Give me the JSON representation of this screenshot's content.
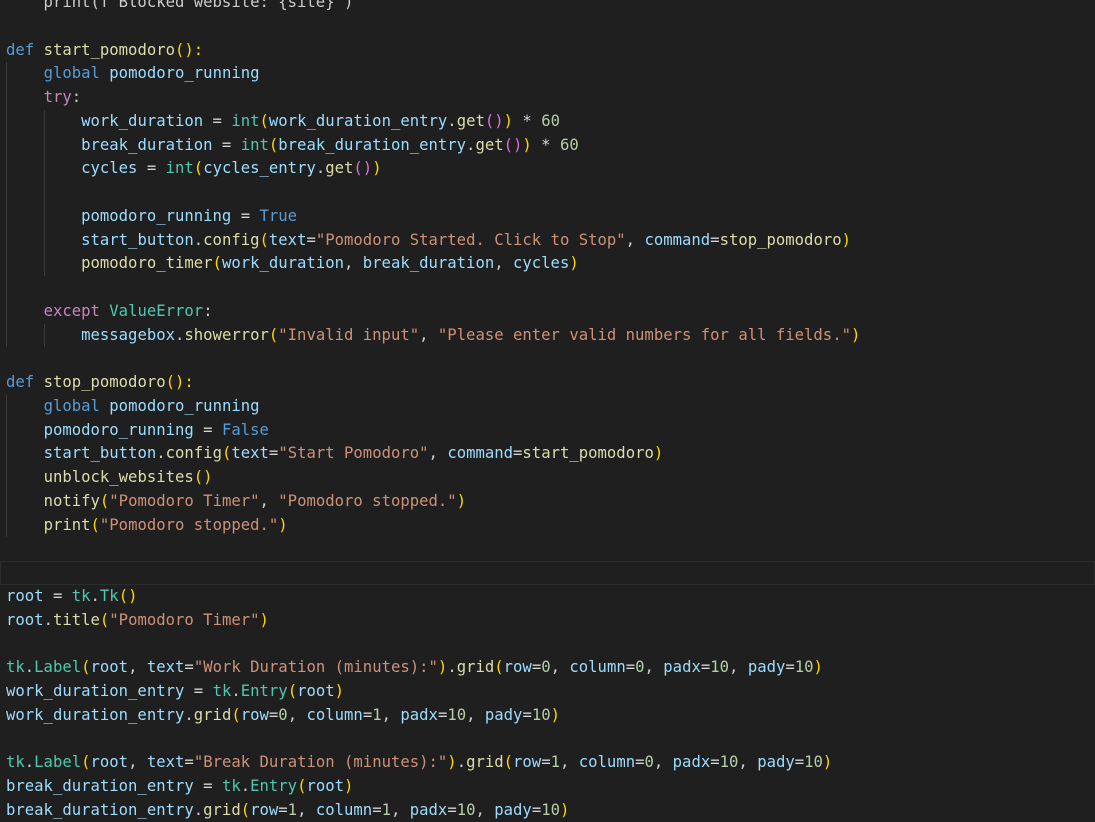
{
  "editor": {
    "lines": [
      {
        "indent": 0,
        "tokens": [
          {
            "t": "    print(f\"Blocked website: {site}\")",
            "c": "pn"
          }
        ]
      },
      {
        "indent": 0,
        "tokens": []
      },
      {
        "indent": 0,
        "tokens": [
          {
            "t": "def",
            "c": "kw"
          },
          {
            "t": " ",
            "c": "pn"
          },
          {
            "t": "start_pomodoro",
            "c": "fn"
          },
          {
            "t": "():",
            "c": "b1"
          }
        ]
      },
      {
        "indent": 1,
        "tokens": [
          {
            "t": "global",
            "c": "kw"
          },
          {
            "t": " ",
            "c": "pn"
          },
          {
            "t": "pomodoro_running",
            "c": "var"
          }
        ]
      },
      {
        "indent": 1,
        "tokens": [
          {
            "t": "try",
            "c": "ctl"
          },
          {
            "t": ":",
            "c": "pn"
          }
        ]
      },
      {
        "indent": 2,
        "tokens": [
          {
            "t": "work_duration",
            "c": "var"
          },
          {
            "t": " = ",
            "c": "op"
          },
          {
            "t": "int",
            "c": "cls"
          },
          {
            "t": "(",
            "c": "b1"
          },
          {
            "t": "work_duration_entry",
            "c": "var"
          },
          {
            "t": ".",
            "c": "pn"
          },
          {
            "t": "get",
            "c": "fn"
          },
          {
            "t": "()",
            "c": "b2"
          },
          {
            "t": ")",
            "c": "b1"
          },
          {
            "t": " * ",
            "c": "op"
          },
          {
            "t": "60",
            "c": "num"
          }
        ]
      },
      {
        "indent": 2,
        "tokens": [
          {
            "t": "break_duration",
            "c": "var"
          },
          {
            "t": " = ",
            "c": "op"
          },
          {
            "t": "int",
            "c": "cls"
          },
          {
            "t": "(",
            "c": "b1"
          },
          {
            "t": "break_duration_entry",
            "c": "var"
          },
          {
            "t": ".",
            "c": "pn"
          },
          {
            "t": "get",
            "c": "fn"
          },
          {
            "t": "()",
            "c": "b2"
          },
          {
            "t": ")",
            "c": "b1"
          },
          {
            "t": " * ",
            "c": "op"
          },
          {
            "t": "60",
            "c": "num"
          }
        ]
      },
      {
        "indent": 2,
        "tokens": [
          {
            "t": "cycles",
            "c": "var"
          },
          {
            "t": " = ",
            "c": "op"
          },
          {
            "t": "int",
            "c": "cls"
          },
          {
            "t": "(",
            "c": "b1"
          },
          {
            "t": "cycles_entry",
            "c": "var"
          },
          {
            "t": ".",
            "c": "pn"
          },
          {
            "t": "get",
            "c": "fn"
          },
          {
            "t": "()",
            "c": "b2"
          },
          {
            "t": ")",
            "c": "b1"
          }
        ]
      },
      {
        "indent": 2,
        "tokens": []
      },
      {
        "indent": 2,
        "tokens": [
          {
            "t": "pomodoro_running",
            "c": "var"
          },
          {
            "t": " = ",
            "c": "op"
          },
          {
            "t": "True",
            "c": "con"
          }
        ]
      },
      {
        "indent": 2,
        "tokens": [
          {
            "t": "start_button",
            "c": "var"
          },
          {
            "t": ".",
            "c": "pn"
          },
          {
            "t": "config",
            "c": "fn"
          },
          {
            "t": "(",
            "c": "b1"
          },
          {
            "t": "text",
            "c": "var"
          },
          {
            "t": "=",
            "c": "op"
          },
          {
            "t": "\"Pomodoro Started. Click to Stop\"",
            "c": "str"
          },
          {
            "t": ", ",
            "c": "pn"
          },
          {
            "t": "command",
            "c": "var"
          },
          {
            "t": "=",
            "c": "op"
          },
          {
            "t": "stop_pomodoro",
            "c": "fn"
          },
          {
            "t": ")",
            "c": "b1"
          }
        ]
      },
      {
        "indent": 2,
        "tokens": [
          {
            "t": "pomodoro_timer",
            "c": "fn"
          },
          {
            "t": "(",
            "c": "b1"
          },
          {
            "t": "work_duration",
            "c": "var"
          },
          {
            "t": ", ",
            "c": "pn"
          },
          {
            "t": "break_duration",
            "c": "var"
          },
          {
            "t": ", ",
            "c": "pn"
          },
          {
            "t": "cycles",
            "c": "var"
          },
          {
            "t": ")",
            "c": "b1"
          }
        ]
      },
      {
        "indent": 1,
        "tokens": []
      },
      {
        "indent": 1,
        "tokens": [
          {
            "t": "except",
            "c": "ctl"
          },
          {
            "t": " ",
            "c": "pn"
          },
          {
            "t": "ValueError",
            "c": "cls"
          },
          {
            "t": ":",
            "c": "pn"
          }
        ]
      },
      {
        "indent": 2,
        "tokens": [
          {
            "t": "messagebox",
            "c": "var"
          },
          {
            "t": ".",
            "c": "pn"
          },
          {
            "t": "showerror",
            "c": "fn"
          },
          {
            "t": "(",
            "c": "b1"
          },
          {
            "t": "\"Invalid input\"",
            "c": "str"
          },
          {
            "t": ", ",
            "c": "pn"
          },
          {
            "t": "\"Please enter valid numbers for all fields.\"",
            "c": "str"
          },
          {
            "t": ")",
            "c": "b1"
          }
        ]
      },
      {
        "indent": 0,
        "tokens": []
      },
      {
        "indent": 0,
        "tokens": [
          {
            "t": "def",
            "c": "kw"
          },
          {
            "t": " ",
            "c": "pn"
          },
          {
            "t": "stop_pomodoro",
            "c": "fn"
          },
          {
            "t": "():",
            "c": "b1"
          }
        ]
      },
      {
        "indent": 1,
        "tokens": [
          {
            "t": "global",
            "c": "kw"
          },
          {
            "t": " ",
            "c": "pn"
          },
          {
            "t": "pomodoro_running",
            "c": "var"
          }
        ]
      },
      {
        "indent": 1,
        "tokens": [
          {
            "t": "pomodoro_running",
            "c": "var"
          },
          {
            "t": " = ",
            "c": "op"
          },
          {
            "t": "False",
            "c": "con"
          }
        ]
      },
      {
        "indent": 1,
        "tokens": [
          {
            "t": "start_button",
            "c": "var"
          },
          {
            "t": ".",
            "c": "pn"
          },
          {
            "t": "config",
            "c": "fn"
          },
          {
            "t": "(",
            "c": "b1"
          },
          {
            "t": "text",
            "c": "var"
          },
          {
            "t": "=",
            "c": "op"
          },
          {
            "t": "\"Start Pomodoro\"",
            "c": "str"
          },
          {
            "t": ", ",
            "c": "pn"
          },
          {
            "t": "command",
            "c": "var"
          },
          {
            "t": "=",
            "c": "op"
          },
          {
            "t": "start_pomodoro",
            "c": "fn"
          },
          {
            "t": ")",
            "c": "b1"
          }
        ]
      },
      {
        "indent": 1,
        "tokens": [
          {
            "t": "unblock_websites",
            "c": "fn"
          },
          {
            "t": "()",
            "c": "b1"
          }
        ]
      },
      {
        "indent": 1,
        "tokens": [
          {
            "t": "notify",
            "c": "fn"
          },
          {
            "t": "(",
            "c": "b1"
          },
          {
            "t": "\"Pomodoro Timer\"",
            "c": "str"
          },
          {
            "t": ", ",
            "c": "pn"
          },
          {
            "t": "\"Pomodoro stopped.\"",
            "c": "str"
          },
          {
            "t": ")",
            "c": "b1"
          }
        ]
      },
      {
        "indent": 1,
        "tokens": [
          {
            "t": "print",
            "c": "fn"
          },
          {
            "t": "(",
            "c": "b1"
          },
          {
            "t": "\"Pomodoro stopped.\"",
            "c": "str"
          },
          {
            "t": ")",
            "c": "b1"
          }
        ]
      },
      {
        "indent": 0,
        "tokens": []
      },
      {
        "indent": 0,
        "current": true,
        "tokens": []
      },
      {
        "indent": 0,
        "tokens": [
          {
            "t": "root",
            "c": "var"
          },
          {
            "t": " = ",
            "c": "op"
          },
          {
            "t": "tk",
            "c": "cls"
          },
          {
            "t": ".",
            "c": "pn"
          },
          {
            "t": "Tk",
            "c": "cls"
          },
          {
            "t": "()",
            "c": "b1"
          }
        ]
      },
      {
        "indent": 0,
        "tokens": [
          {
            "t": "root",
            "c": "var"
          },
          {
            "t": ".",
            "c": "pn"
          },
          {
            "t": "title",
            "c": "fn"
          },
          {
            "t": "(",
            "c": "b1"
          },
          {
            "t": "\"Pomodoro Timer\"",
            "c": "str"
          },
          {
            "t": ")",
            "c": "b1"
          }
        ]
      },
      {
        "indent": 0,
        "tokens": []
      },
      {
        "indent": 0,
        "tokens": [
          {
            "t": "tk",
            "c": "cls"
          },
          {
            "t": ".",
            "c": "pn"
          },
          {
            "t": "Label",
            "c": "cls"
          },
          {
            "t": "(",
            "c": "b1"
          },
          {
            "t": "root",
            "c": "var"
          },
          {
            "t": ", ",
            "c": "pn"
          },
          {
            "t": "text",
            "c": "var"
          },
          {
            "t": "=",
            "c": "op"
          },
          {
            "t": "\"Work Duration (minutes):\"",
            "c": "str"
          },
          {
            "t": ")",
            "c": "b1"
          },
          {
            "t": ".",
            "c": "pn"
          },
          {
            "t": "grid",
            "c": "fn"
          },
          {
            "t": "(",
            "c": "b1"
          },
          {
            "t": "row",
            "c": "var"
          },
          {
            "t": "=",
            "c": "op"
          },
          {
            "t": "0",
            "c": "num"
          },
          {
            "t": ", ",
            "c": "pn"
          },
          {
            "t": "column",
            "c": "var"
          },
          {
            "t": "=",
            "c": "op"
          },
          {
            "t": "0",
            "c": "num"
          },
          {
            "t": ", ",
            "c": "pn"
          },
          {
            "t": "padx",
            "c": "var"
          },
          {
            "t": "=",
            "c": "op"
          },
          {
            "t": "10",
            "c": "num"
          },
          {
            "t": ", ",
            "c": "pn"
          },
          {
            "t": "pady",
            "c": "var"
          },
          {
            "t": "=",
            "c": "op"
          },
          {
            "t": "10",
            "c": "num"
          },
          {
            "t": ")",
            "c": "b1"
          }
        ]
      },
      {
        "indent": 0,
        "tokens": [
          {
            "t": "work_duration_entry",
            "c": "var"
          },
          {
            "t": " = ",
            "c": "op"
          },
          {
            "t": "tk",
            "c": "cls"
          },
          {
            "t": ".",
            "c": "pn"
          },
          {
            "t": "Entry",
            "c": "cls"
          },
          {
            "t": "(",
            "c": "b1"
          },
          {
            "t": "root",
            "c": "var"
          },
          {
            "t": ")",
            "c": "b1"
          }
        ]
      },
      {
        "indent": 0,
        "tokens": [
          {
            "t": "work_duration_entry",
            "c": "var"
          },
          {
            "t": ".",
            "c": "pn"
          },
          {
            "t": "grid",
            "c": "fn"
          },
          {
            "t": "(",
            "c": "b1"
          },
          {
            "t": "row",
            "c": "var"
          },
          {
            "t": "=",
            "c": "op"
          },
          {
            "t": "0",
            "c": "num"
          },
          {
            "t": ", ",
            "c": "pn"
          },
          {
            "t": "column",
            "c": "var"
          },
          {
            "t": "=",
            "c": "op"
          },
          {
            "t": "1",
            "c": "num"
          },
          {
            "t": ", ",
            "c": "pn"
          },
          {
            "t": "padx",
            "c": "var"
          },
          {
            "t": "=",
            "c": "op"
          },
          {
            "t": "10",
            "c": "num"
          },
          {
            "t": ", ",
            "c": "pn"
          },
          {
            "t": "pady",
            "c": "var"
          },
          {
            "t": "=",
            "c": "op"
          },
          {
            "t": "10",
            "c": "num"
          },
          {
            "t": ")",
            "c": "b1"
          }
        ]
      },
      {
        "indent": 0,
        "tokens": []
      },
      {
        "indent": 0,
        "tokens": [
          {
            "t": "tk",
            "c": "cls"
          },
          {
            "t": ".",
            "c": "pn"
          },
          {
            "t": "Label",
            "c": "cls"
          },
          {
            "t": "(",
            "c": "b1"
          },
          {
            "t": "root",
            "c": "var"
          },
          {
            "t": ", ",
            "c": "pn"
          },
          {
            "t": "text",
            "c": "var"
          },
          {
            "t": "=",
            "c": "op"
          },
          {
            "t": "\"Break Duration (minutes):\"",
            "c": "str"
          },
          {
            "t": ")",
            "c": "b1"
          },
          {
            "t": ".",
            "c": "pn"
          },
          {
            "t": "grid",
            "c": "fn"
          },
          {
            "t": "(",
            "c": "b1"
          },
          {
            "t": "row",
            "c": "var"
          },
          {
            "t": "=",
            "c": "op"
          },
          {
            "t": "1",
            "c": "num"
          },
          {
            "t": ", ",
            "c": "pn"
          },
          {
            "t": "column",
            "c": "var"
          },
          {
            "t": "=",
            "c": "op"
          },
          {
            "t": "0",
            "c": "num"
          },
          {
            "t": ", ",
            "c": "pn"
          },
          {
            "t": "padx",
            "c": "var"
          },
          {
            "t": "=",
            "c": "op"
          },
          {
            "t": "10",
            "c": "num"
          },
          {
            "t": ", ",
            "c": "pn"
          },
          {
            "t": "pady",
            "c": "var"
          },
          {
            "t": "=",
            "c": "op"
          },
          {
            "t": "10",
            "c": "num"
          },
          {
            "t": ")",
            "c": "b1"
          }
        ]
      },
      {
        "indent": 0,
        "tokens": [
          {
            "t": "break_duration_entry",
            "c": "var"
          },
          {
            "t": " = ",
            "c": "op"
          },
          {
            "t": "tk",
            "c": "cls"
          },
          {
            "t": ".",
            "c": "pn"
          },
          {
            "t": "Entry",
            "c": "cls"
          },
          {
            "t": "(",
            "c": "b1"
          },
          {
            "t": "root",
            "c": "var"
          },
          {
            "t": ")",
            "c": "b1"
          }
        ]
      },
      {
        "indent": 0,
        "tokens": [
          {
            "t": "break_duration_entry",
            "c": "var"
          },
          {
            "t": ".",
            "c": "pn"
          },
          {
            "t": "grid",
            "c": "fn"
          },
          {
            "t": "(",
            "c": "b1"
          },
          {
            "t": "row",
            "c": "var"
          },
          {
            "t": "=",
            "c": "op"
          },
          {
            "t": "1",
            "c": "num"
          },
          {
            "t": ", ",
            "c": "pn"
          },
          {
            "t": "column",
            "c": "var"
          },
          {
            "t": "=",
            "c": "op"
          },
          {
            "t": "1",
            "c": "num"
          },
          {
            "t": ", ",
            "c": "pn"
          },
          {
            "t": "padx",
            "c": "var"
          },
          {
            "t": "=",
            "c": "op"
          },
          {
            "t": "10",
            "c": "num"
          },
          {
            "t": ", ",
            "c": "pn"
          },
          {
            "t": "pady",
            "c": "var"
          },
          {
            "t": "=",
            "c": "op"
          },
          {
            "t": "10",
            "c": "num"
          },
          {
            "t": ")",
            "c": "b1"
          }
        ]
      }
    ]
  }
}
